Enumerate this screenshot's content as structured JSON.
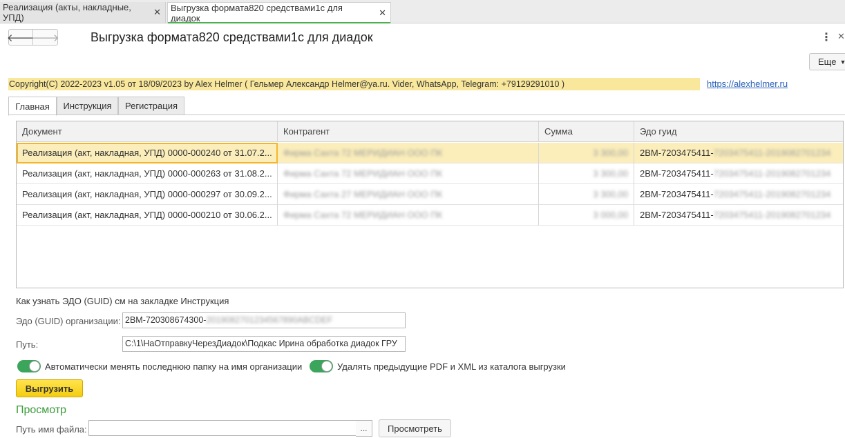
{
  "tabs": [
    {
      "label": "Реализация (акты, накладные, УПД)"
    },
    {
      "label": "Выгрузка формата820 средствами1с для диадок"
    }
  ],
  "window": {
    "title": "Выгрузка формата820 средствами1с для диадок",
    "more_label": "Еще"
  },
  "info": {
    "copyright": "Copyright(C)  2022-2023 v1.05 от 18/09/2023  by Alex Helmer ( Гельмер Александр Helmer@ya.ru. Vider, WhatsApp, Telegram: +79129291010 )",
    "link": "https://alexhelmer.ru"
  },
  "form_tabs": [
    {
      "label": "Главная"
    },
    {
      "label": "Инструкция"
    },
    {
      "label": "Регистрация"
    }
  ],
  "table": {
    "columns": [
      "Документ",
      "Контрагент",
      "Сумма",
      "Эдо гуид"
    ],
    "rows": [
      {
        "doc": "Реализация (акт, накладная, УПД) 0000-000240 от 31.07.2...",
        "counterparty": "Фирма Сахта 72 МЕРИДИАН ООО ПК",
        "sum": "3 300,00",
        "edo": "2ВМ-7203475411-",
        "edo_hidden": "7203475411-2019082701234"
      },
      {
        "doc": "Реализация (акт, накладная, УПД) 0000-000263 от 31.08.2...",
        "counterparty": "Фирма Сахта 72 МЕРИДИАН ООО ПК",
        "sum": "3 300,00",
        "edo": "2ВМ-7203475411-",
        "edo_hidden": "7203475411-2019082701234"
      },
      {
        "doc": "Реализация (акт, накладная, УПД) 0000-000297 от 30.09.2...",
        "counterparty": "Фирма Сахта 27 МЕРИДИАН ООО ПК",
        "sum": "3 300,00",
        "edo": "2ВМ-7203475411-",
        "edo_hidden": "7203475411-2019082701234"
      },
      {
        "doc": "Реализация (акт, накладная, УПД) 0000-000210 от 30.06.2...",
        "counterparty": "Фирма Сахта 72 МЕРИДИАН ООО ПК",
        "sum": "3 000,00",
        "edo": "2ВМ-7203475411-",
        "edo_hidden": "7203475411-2019082701234"
      }
    ]
  },
  "form": {
    "hint": "Как узнать ЭДО (GUID) см на закладке Инструкция",
    "edo_label": "Эдо (GUID) организации:",
    "edo_value": "2ВМ-720308674300-",
    "edo_value_hidden": "2019082701234567890ABCDEF",
    "path_label": "Путь:",
    "path_value": "C:\\1\\НаОтправкуЧерезДиадок\\Подкас Ирина обработка диадок ГРУ",
    "toggle1_label": "Автоматически менять последнюю папку на имя организации",
    "toggle2_label": "Удалять предыдущие PDF и XML из каталога выгрузки",
    "upload_label": "Выгрузить"
  },
  "preview": {
    "title": "Просмотр",
    "file_label": "Путь имя файла:",
    "file_value": "",
    "select_label": "...",
    "view_label": "Просмотреть"
  },
  "colors": {
    "accent_green": "#4caf50",
    "copyright_bg": "#f9e79b",
    "selected_row": "#fbeebb",
    "button_yellow": "#f4cd10"
  }
}
